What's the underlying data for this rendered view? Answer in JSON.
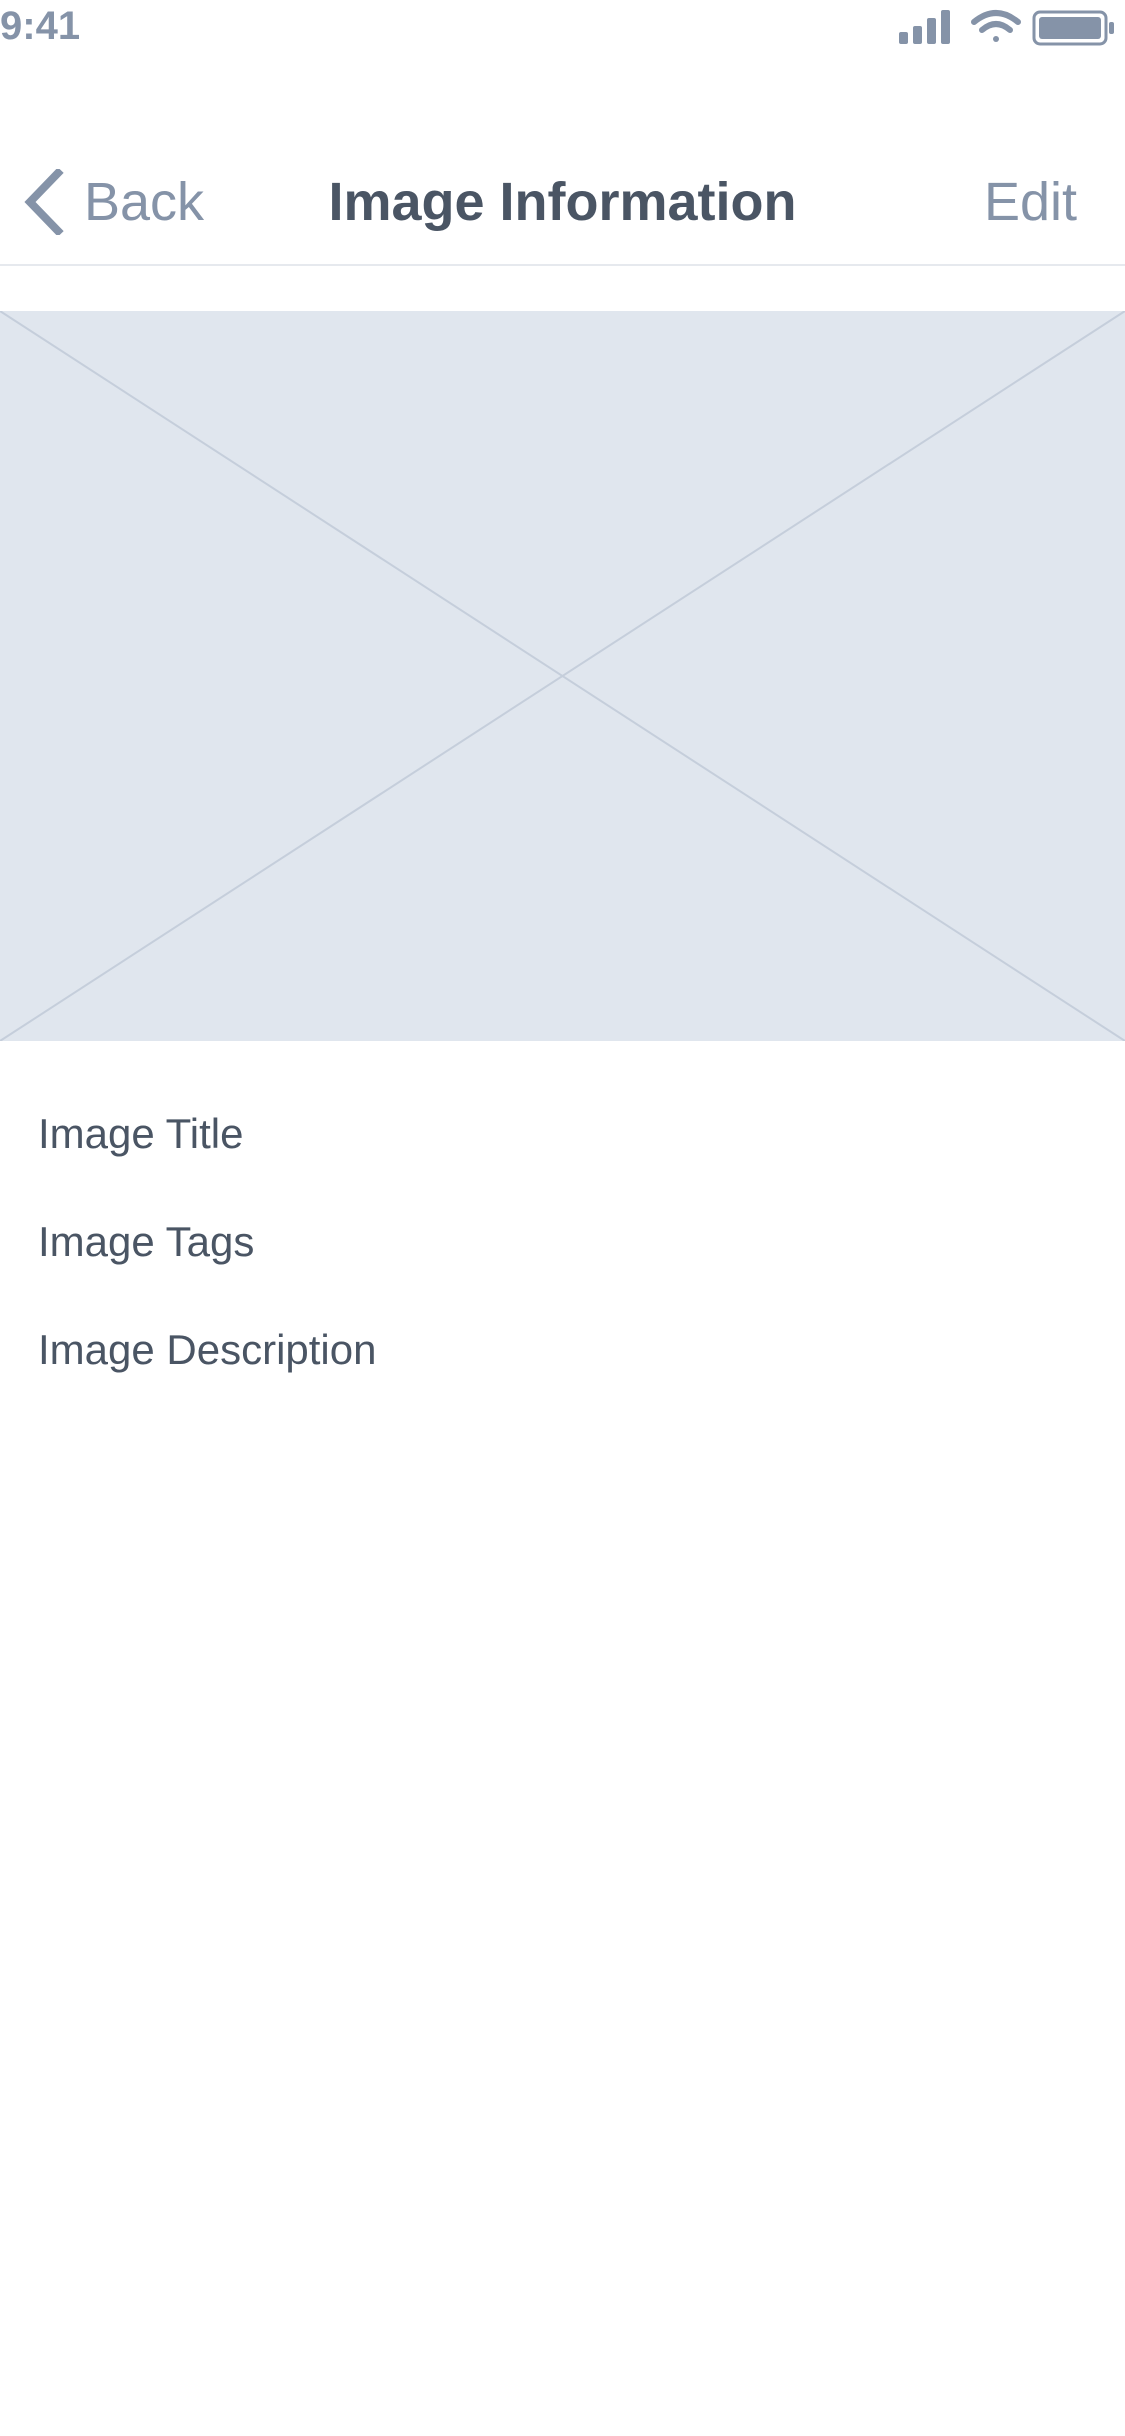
{
  "status_bar": {
    "time": "9:41",
    "icons": [
      "signal-icon",
      "wifi-icon",
      "battery-icon"
    ]
  },
  "nav": {
    "back_label": "Back",
    "title": "Image Information",
    "edit_label": "Edit"
  },
  "image": {
    "placeholder_icon": "image-placeholder-icon"
  },
  "info": {
    "title_label": "Image Title",
    "tags_label": "Image Tags",
    "description_label": "Image Description"
  },
  "colors": {
    "accent": "#8593a8",
    "text": "#4a5564",
    "placeholder_bg": "#e0e6ee",
    "placeholder_line": "#c5cedb"
  }
}
